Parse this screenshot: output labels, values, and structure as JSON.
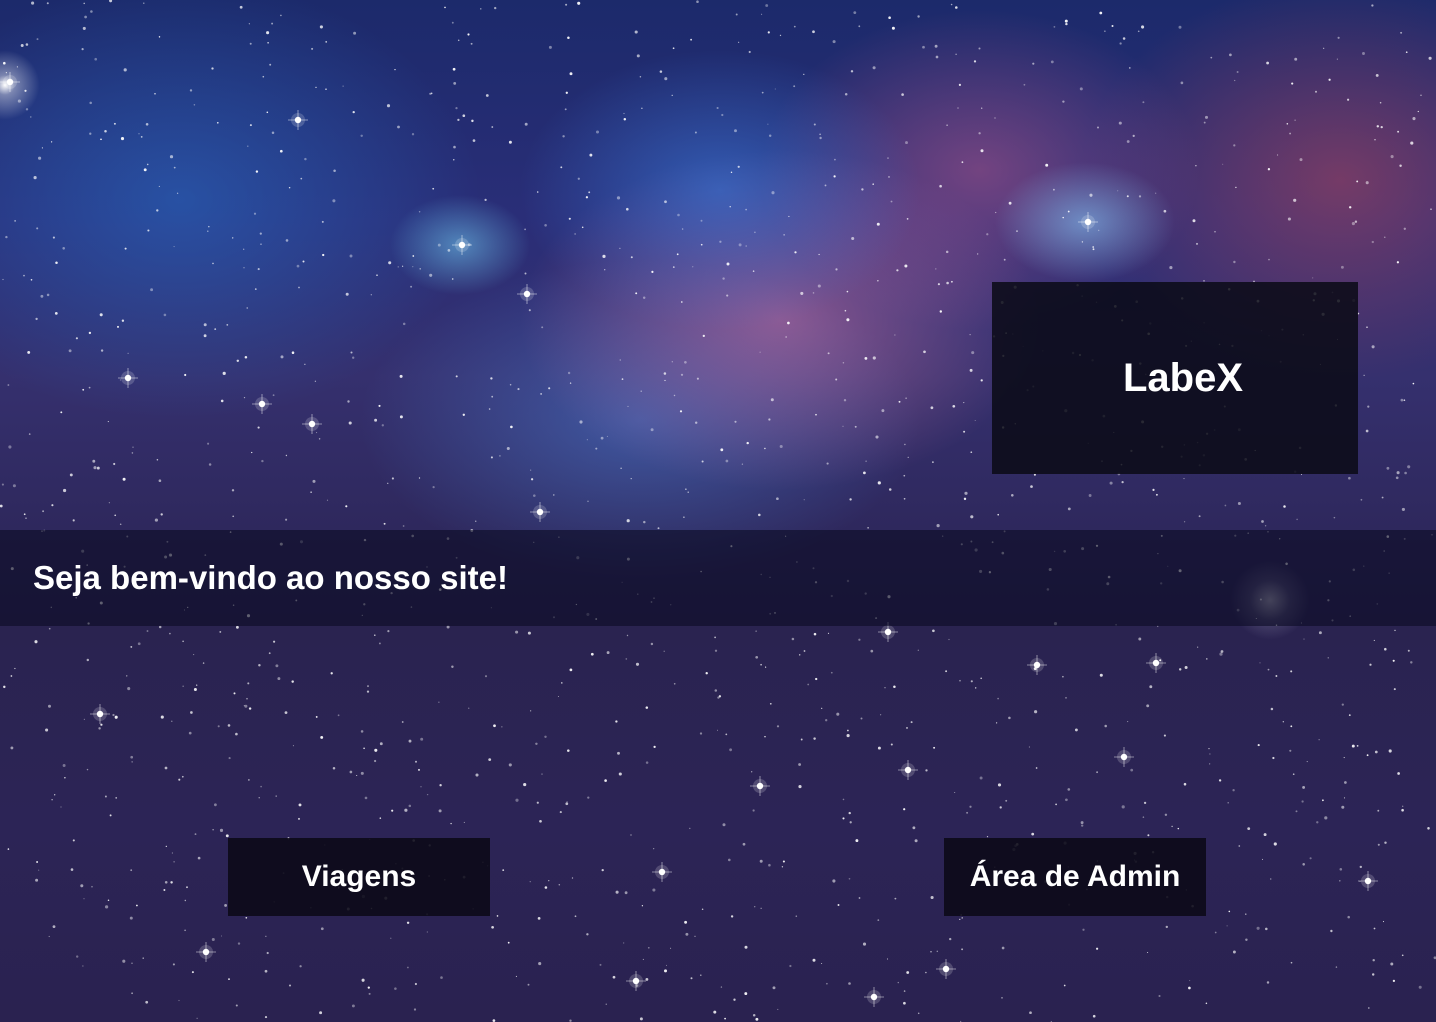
{
  "brand": {
    "name": "LabeX"
  },
  "hero": {
    "welcome": "Seja bem-vindo ao nosso site!"
  },
  "nav": {
    "trips_label": "Viagens",
    "admin_label": "Área de Admin"
  },
  "colors": {
    "text": "#ffffff",
    "panel": "#0a0a16",
    "sky_top": "#2a2e78",
    "sky_bottom": "#2a2350"
  }
}
